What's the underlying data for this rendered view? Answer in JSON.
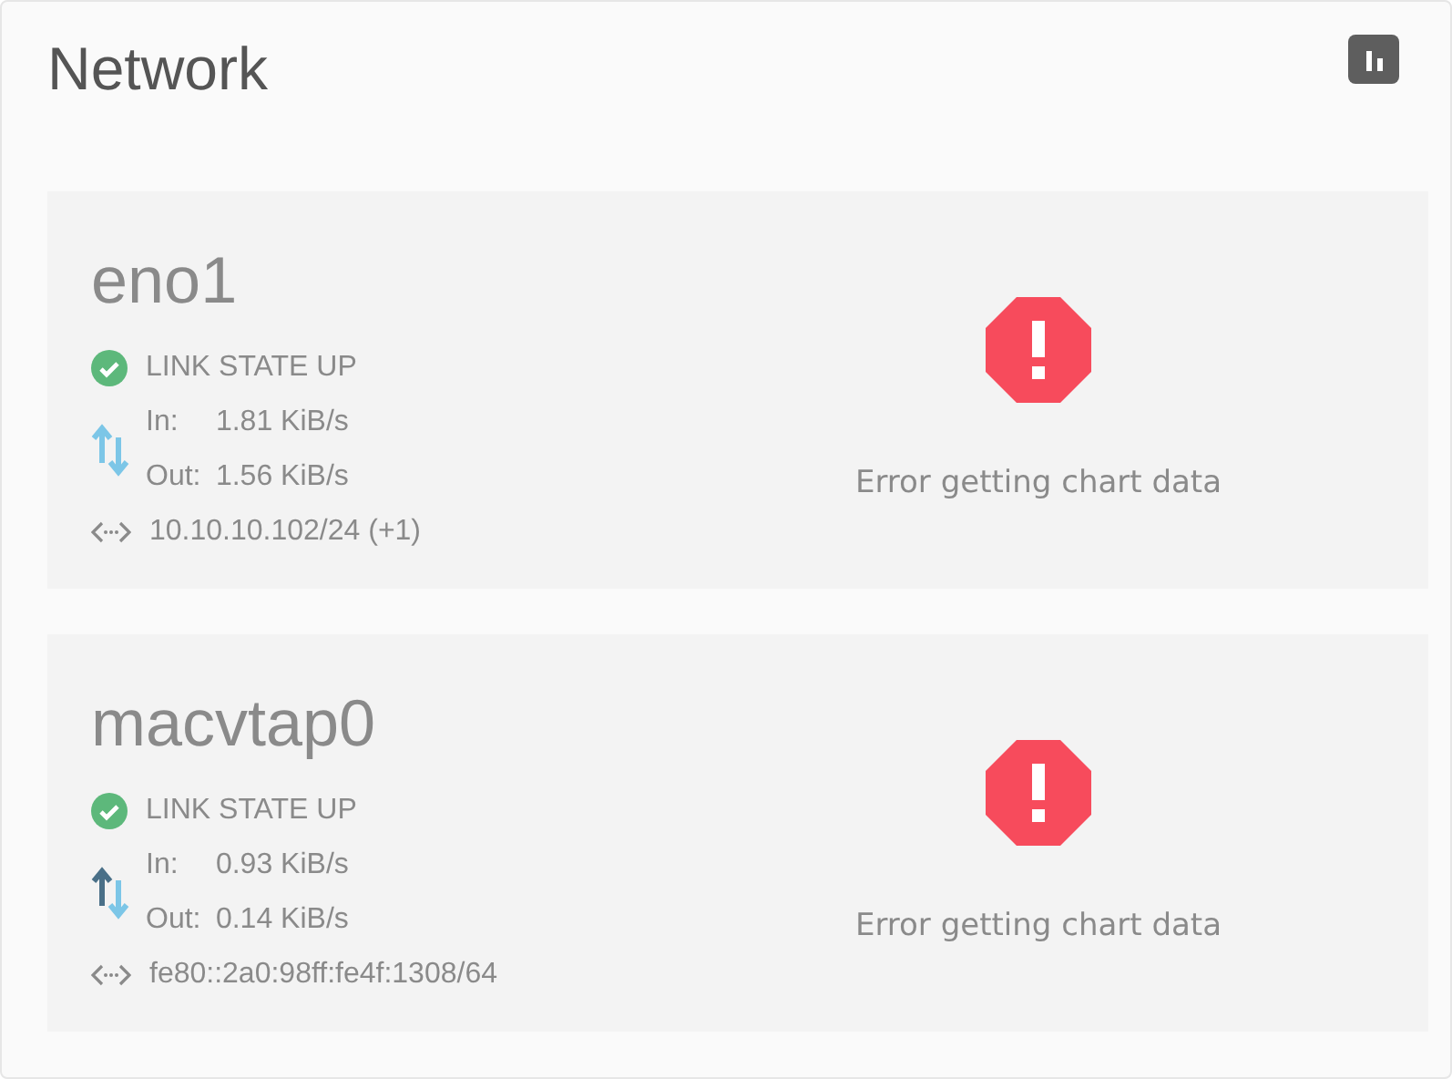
{
  "panel": {
    "title": "Network"
  },
  "interfaces": [
    {
      "name": "eno1",
      "link_state": "LINK STATE UP",
      "link_up": true,
      "in_label": "In:",
      "in_rate": "1.81 KiB/s",
      "out_label": "Out:",
      "out_rate": "1.56 KiB/s",
      "upload_highlighted": false,
      "address": "10.10.10.102/24 (+1)",
      "chart_error": "Error getting chart data"
    },
    {
      "name": "macvtap0",
      "link_state": "LINK STATE UP",
      "link_up": true,
      "in_label": "In:",
      "in_rate": "0.93 KiB/s",
      "out_label": "Out:",
      "out_rate": "0.14 KiB/s",
      "upload_highlighted": true,
      "address": "fe80::2a0:98ff:fe4f:1308/64",
      "chart_error": "Error getting chart data"
    }
  ]
}
